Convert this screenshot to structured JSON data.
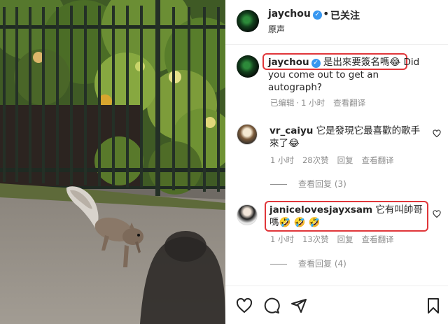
{
  "post": {
    "username": "jaychou",
    "follow_status": "已关注",
    "audio": "原声"
  },
  "caption": {
    "username": "jaychou",
    "text": "是出來要簽名嗎😂 Did you come out to get an autograph?",
    "edited": "已编辑",
    "time": "1 小时",
    "translate": "查看翻译"
  },
  "comments": [
    {
      "username": "vr_caiyu",
      "text": "它是發現它最喜歡的歌手來了😂",
      "time": "1 小时",
      "likes": "28次赞",
      "reply": "回复",
      "translate": "查看翻译",
      "view_replies": "查看回复 (3)"
    },
    {
      "username": "janicelovesjayxsam",
      "text": "它有叫帥哥嗎🤣 🤣 🤣",
      "time": "1 小时",
      "likes": "13次赞",
      "reply": "回复",
      "translate": "查看翻译",
      "view_replies": "查看回复 (4)"
    }
  ],
  "icons": [
    "heart-icon",
    "comment-icon",
    "share-icon",
    "bookmark-icon",
    "verified-badge-icon"
  ],
  "colors": {
    "verified": "#3897f0",
    "highlight": "#e0363a",
    "meta": "#8e8e8e"
  }
}
